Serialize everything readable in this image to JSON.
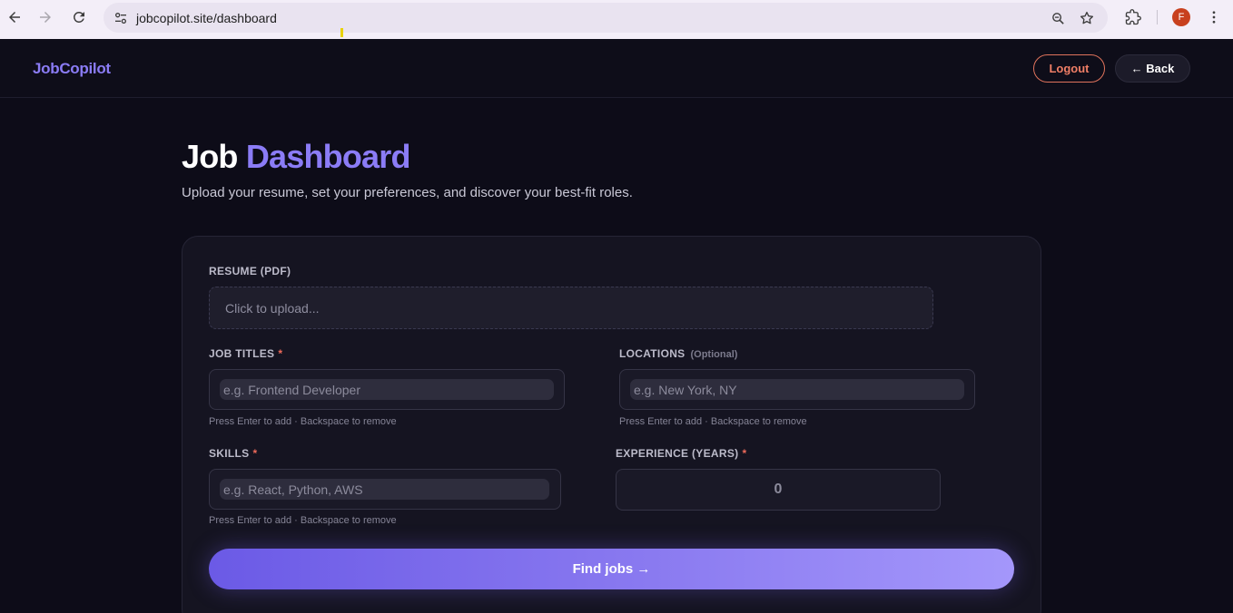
{
  "browser": {
    "url": "jobcopilot.site/dashboard",
    "profile_initial": "F"
  },
  "header": {
    "logo": "JobCopilot",
    "logout_label": "Logout",
    "back_label": "← Back"
  },
  "page": {
    "title_part1": "Job",
    "title_part2": "Dashboard",
    "subtitle": "Upload your resume, set your preferences, and discover your best-fit roles."
  },
  "form": {
    "resume_label": "RESUME (PDF)",
    "resume_placeholder": "Click to upload...",
    "job_titles_label": "JOB TITLES",
    "job_titles_required": "*",
    "job_titles_placeholder": "e.g. Frontend Developer",
    "job_titles_hint": "Press Enter to add · Backspace to remove",
    "locations_label": "LOCATIONS",
    "locations_optional": "(Optional)",
    "locations_placeholder": "e.g. New York, NY",
    "locations_hint": "Press Enter to add · Backspace to remove",
    "skills_label": "SKILLS",
    "skills_required": "*",
    "skills_placeholder": "e.g. React, Python, AWS",
    "skills_hint": "Press Enter to add · Backspace to remove",
    "experience_label": "EXPERIENCE (YEARS)",
    "experience_required": "*",
    "experience_value": "0",
    "submit_label": "Find jobs →"
  },
  "colors": {
    "accent": "#8b7cf6",
    "background": "#0d0c18",
    "logout": "#ef7e66",
    "required": "#ee6a5a"
  }
}
